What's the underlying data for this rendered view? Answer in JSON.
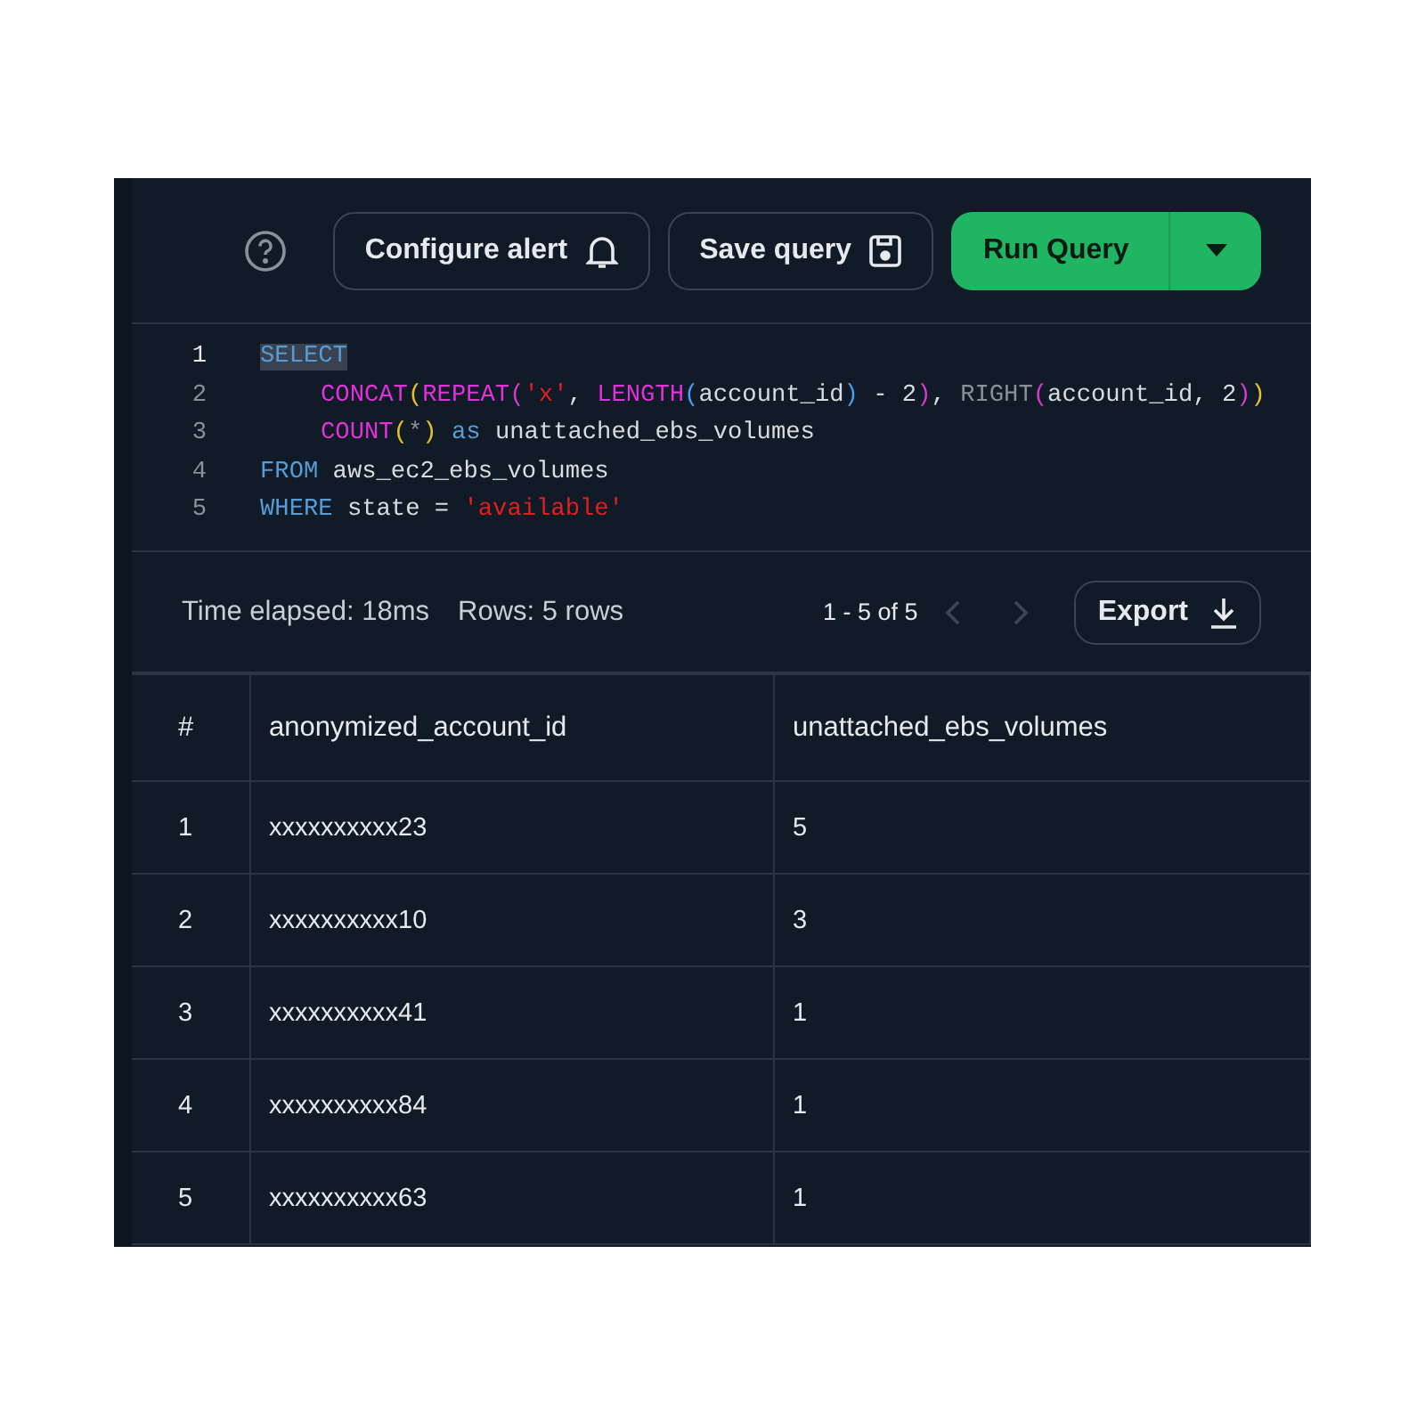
{
  "toolbar": {
    "buttons": [
      {
        "label": "Configure alert",
        "kind": "alert"
      },
      {
        "label": "Save query",
        "kind": "save"
      }
    ],
    "run_button": {
      "label": "Run Query"
    }
  },
  "editor": {
    "lines": [
      {
        "number": "1",
        "indent": false,
        "tokens": [
          {
            "text": "SELECT",
            "kind": "selection"
          }
        ]
      },
      {
        "number": "2",
        "indent": true,
        "tokens": [
          {
            "text": "CONCAT",
            "kind": "function"
          },
          {
            "text": "(",
            "kind": "bracket1"
          },
          {
            "text": "REPEAT",
            "kind": "function"
          },
          {
            "text": "(",
            "kind": "bracket2"
          },
          {
            "text": "'x'",
            "kind": "string"
          },
          {
            "text": ", ",
            "kind": "plain"
          },
          {
            "text": "LENGTH",
            "kind": "function"
          },
          {
            "text": "(",
            "kind": "bracket3"
          },
          {
            "text": "account_id",
            "kind": "plain"
          },
          {
            "text": ")",
            "kind": "bracket3"
          },
          {
            "text": " - 2",
            "kind": "plain"
          },
          {
            "text": ")",
            "kind": "bracket2"
          },
          {
            "text": ", ",
            "kind": "plain"
          },
          {
            "text": "RIGHT",
            "kind": "dim"
          },
          {
            "text": "(",
            "kind": "bracket2"
          },
          {
            "text": "account_id, 2",
            "kind": "plain"
          },
          {
            "text": ")",
            "kind": "bracket2"
          },
          {
            "text": ")",
            "kind": "bracket1"
          }
        ]
      },
      {
        "number": "3",
        "indent": true,
        "tokens": [
          {
            "text": "COUNT",
            "kind": "function"
          },
          {
            "text": "(",
            "kind": "bracket1"
          },
          {
            "text": "*",
            "kind": "dim"
          },
          {
            "text": ")",
            "kind": "bracket1"
          },
          {
            "text": " as",
            "kind": "keyword"
          },
          {
            "text": " unattached_ebs_volumes",
            "kind": "plain"
          }
        ]
      },
      {
        "number": "4",
        "indent": false,
        "tokens": [
          {
            "text": "FROM",
            "kind": "keyword"
          },
          {
            "text": " aws_ec2_ebs_volumes",
            "kind": "plain"
          }
        ]
      },
      {
        "number": "5",
        "indent": false,
        "tokens": [
          {
            "text": "WHERE",
            "kind": "keyword"
          },
          {
            "text": " state = ",
            "kind": "plain"
          },
          {
            "text": "'available'",
            "kind": "string"
          }
        ]
      }
    ]
  },
  "status_bar": {
    "time_elapsed": "Time elapsed: 18ms",
    "rows": "Rows: 5 rows",
    "range": "1 - 5 of 5",
    "prev_disabled": true,
    "next_disabled": true,
    "export_label": "Export"
  },
  "table": {
    "columns": [
      "#",
      "anonymized_account_id",
      "unattached_ebs_volumes"
    ],
    "rows": [
      [
        "1",
        "xxxxxxxxxx23",
        "5"
      ],
      [
        "2",
        "xxxxxxxxxx10",
        "3"
      ],
      [
        "3",
        "xxxxxxxxxx41",
        "1"
      ],
      [
        "4",
        "xxxxxxxxxx84",
        "1"
      ],
      [
        "5",
        "xxxxxxxxxx63",
        "1"
      ]
    ]
  }
}
